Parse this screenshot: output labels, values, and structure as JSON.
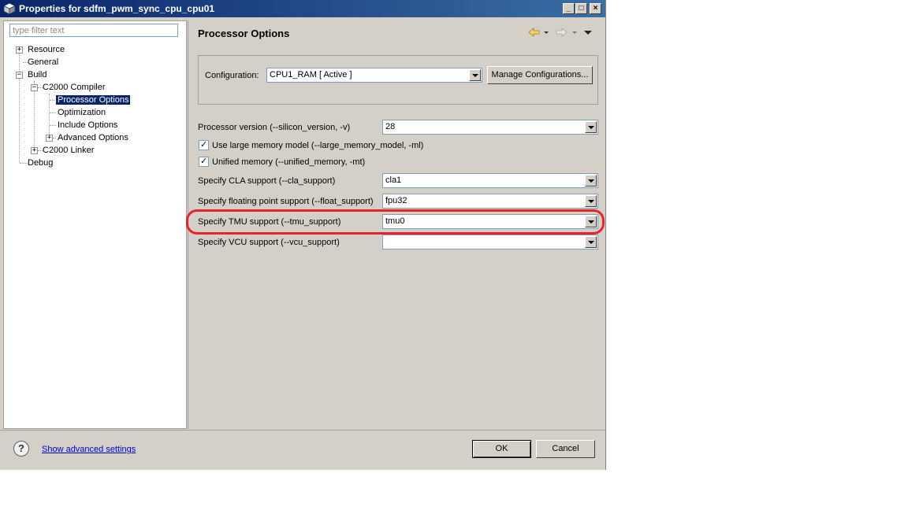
{
  "window": {
    "title": "Properties for sdfm_pwm_sync_cpu_cpu01"
  },
  "filter": {
    "placeholder": "type filter text",
    "value": ""
  },
  "tree": {
    "resource": "Resource",
    "general": "General",
    "build": "Build",
    "compiler": "C2000 Compiler",
    "processor_options": "Processor Options",
    "optimization": "Optimization",
    "include_options": "Include Options",
    "advanced_options": "Advanced Options",
    "linker": "C2000 Linker",
    "debug": "Debug",
    "selected": "Processor Options"
  },
  "page": {
    "title": "Processor Options"
  },
  "configuration": {
    "label": "Configuration:",
    "value": "CPU1_RAM  [ Active ]",
    "manage_label": "Manage Configurations..."
  },
  "options": {
    "processor_version": {
      "label": "Processor version (--silicon_version, -v)",
      "value": "28"
    },
    "large_memory": {
      "label": "Use large memory model (--large_memory_model, -ml)",
      "checked": true
    },
    "unified_memory": {
      "label": "Unified memory (--unified_memory, -mt)",
      "checked": true
    },
    "cla": {
      "label": "Specify CLA support (--cla_support)",
      "value": "cla1"
    },
    "float": {
      "label": "Specify floating point support (--float_support)",
      "value": "fpu32"
    },
    "tmu": {
      "label": "Specify TMU support (--tmu_support)",
      "value": "tmu0"
    },
    "vcu": {
      "label": "Specify VCU support (--vcu_support)",
      "value": ""
    }
  },
  "footer": {
    "help_symbol": "?",
    "advanced_link": "Show advanced settings",
    "ok_label": "OK",
    "cancel_label": "Cancel"
  },
  "annotation": {
    "highlight_color": "#e8232b"
  }
}
